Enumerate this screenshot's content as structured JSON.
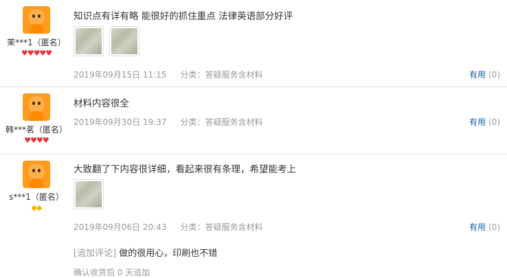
{
  "reviews": [
    {
      "user": "茉***1（匿名）",
      "level_icons": "♥♥♥♥♥",
      "text": "知识点有详有略 能很好的抓住重点 法律英语部分好评",
      "date": "2019年09月15日 11:15",
      "category": "分类：答疑服务含材料",
      "helpful_label": "有用",
      "helpful_count": "(0)"
    },
    {
      "user": "韩***茗（匿名）",
      "level_icons": "♥♥♥♥",
      "text": "材料内容很全",
      "date": "2019年09月30日 19:37",
      "category": "分类：答疑服务含材料",
      "helpful_label": "有用",
      "helpful_count": "(0)"
    },
    {
      "user": "s***1（匿名）",
      "level_icons": "◆◆",
      "text": "大致翻了下内容很详细，看起来很有条理，希望能考上",
      "date": "2019年09月06日 20:43",
      "category": "分类：答疑服务含材料",
      "helpful_label": "有用",
      "helpful_count": "(0)",
      "append_tag": "[追加评论]",
      "append_text": "做的很用心，印刷也不错",
      "append_time": "确认收货后 0 天追加"
    }
  ],
  "colors": {
    "link": "#1d5fa5",
    "meta": "#999999",
    "level_red": "#e5333a",
    "level_gold": "#f2b400",
    "avatar": "#ff9b1f"
  }
}
